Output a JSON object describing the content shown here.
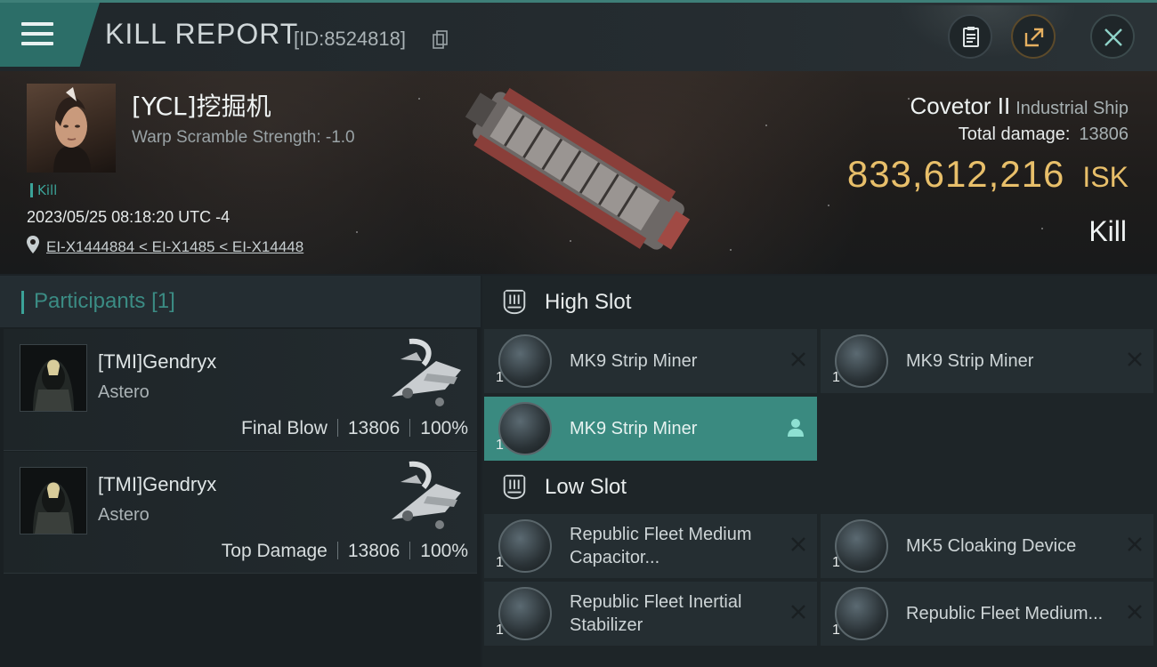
{
  "header": {
    "title": "KILL REPORT",
    "report_id": "[ID:8524818]",
    "icons": [
      "menu-icon",
      "copy-icon",
      "clipboard-icon",
      "share-icon",
      "close-icon"
    ]
  },
  "victim": {
    "name": "[YCL]挖掘机",
    "warp_scramble": "Warp Scramble Strength: -1.0",
    "tag": "Kill",
    "datetime": "2023/05/25 08:18:20 UTC -4",
    "location": "EI-X1444884 < EI-X1485 < EI-X14448",
    "ship": "Covetor II",
    "ship_class": "Industrial Ship",
    "total_damage_label": "Total damage:",
    "total_damage": "13806",
    "isk_value": "833,612,216",
    "isk_unit": "ISK",
    "result": "Kill"
  },
  "participants": {
    "title": "Participants",
    "count": "[1]",
    "rows": [
      {
        "name": "[TMI]Gendryx",
        "ship": "Astero",
        "role": "Final Blow",
        "damage": "13806",
        "percent": "100%"
      },
      {
        "name": "[TMI]Gendryx",
        "ship": "Astero",
        "role": "Top Damage",
        "damage": "13806",
        "percent": "100%"
      }
    ]
  },
  "slots": {
    "high": {
      "title": "High Slot",
      "modules": [
        {
          "name": "MK9 Strip Miner",
          "qty": "1",
          "state": "destroyed"
        },
        {
          "name": "MK9 Strip Miner",
          "qty": "1",
          "state": "destroyed"
        },
        {
          "name": "MK9 Strip Miner",
          "qty": "1",
          "state": "dropped"
        }
      ]
    },
    "low": {
      "title": "Low Slot",
      "modules": [
        {
          "name": "Republic Fleet Medium Capacitor...",
          "qty": "1",
          "state": "destroyed"
        },
        {
          "name": "MK5 Cloaking Device",
          "qty": "1",
          "state": "destroyed"
        },
        {
          "name": "Republic Fleet Inertial Stabilizer",
          "qty": "1",
          "state": "destroyed"
        },
        {
          "name": "Republic Fleet Medium...",
          "qty": "1",
          "state": "destroyed"
        }
      ]
    }
  },
  "colors": {
    "accent": "#3ba398",
    "isk": "#e8bf6a",
    "active_row": "#3a8a80"
  }
}
